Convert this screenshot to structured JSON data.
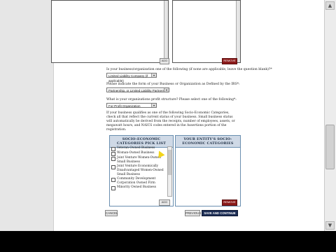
{
  "top_section": {
    "add_label": "ADD",
    "remove_label": "REMOVE"
  },
  "questions": [
    {
      "label": "Is your business/organization one of the following (if none are applicable, leave the question blank)?*",
      "selected": "Limited Liability Company (if applicable)"
    },
    {
      "label": "Please indicate the form of your Business or Organization as Defined by the IRS*:",
      "selected": "Partnership, or Limited Liability Partnership"
    },
    {
      "label": "What is your organizations profit structure? Please select one of the following*:",
      "selected": "For-Profit Organization"
    }
  ],
  "socio_paragraph": "If your business qualifies as one of the following Socio-Economic Categories, check all that reflect the current status of your business. Small business status will automatically be derived from the receipts, number of employees, assets, or megawatt hours, and NAICS codes entered in the Assertions portion of the registration.",
  "pick_list": {
    "header": "SOCIO-ECONOMIC CATEGORIES PICK LIST",
    "items": [
      "Veteran-Owned Business",
      "Woman-Owned Business",
      "Joint Venture Women-Owned Small Business",
      "Joint Venture Economically Disadvantaged Women-Owned Small Business",
      "Community Development Corporation Owned Firm",
      "Minority Owned Business"
    ],
    "add_label": "ADD"
  },
  "entity_panel": {
    "header": "YOUR ENTITY'S SOCIO-ECONOMIC CATEGORIES",
    "remove_label": "REMOVE"
  },
  "nav": {
    "cancel": "CANCEL",
    "previous": "PREVIOUS",
    "continue": "SAVE AND CONTINUE"
  },
  "icons": {
    "scroll_up": "arrow-up-icon",
    "scroll_down": "arrow-down-icon",
    "dropdown": "chevron-down-icon",
    "cursor": "pointer-cursor-icon"
  },
  "colors": {
    "continue_button": "#1c2d55",
    "remove_button": "#8b1a1a",
    "panel_header": "#cfd9e6"
  }
}
